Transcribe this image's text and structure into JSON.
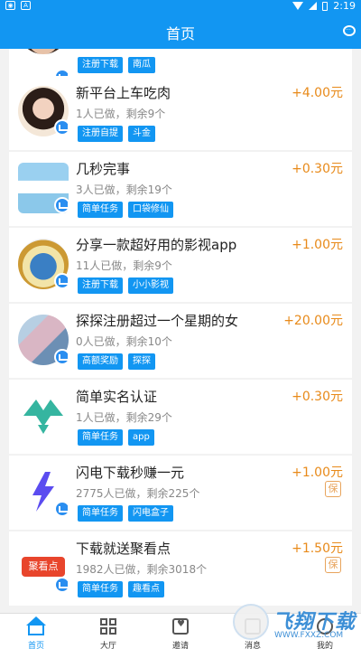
{
  "status_bar": {
    "time": "2:19",
    "left_icons": [
      "game-icon",
      "a-icon"
    ],
    "right_icons": [
      "wifi-icon",
      "signal-icon",
      "battery-icon"
    ]
  },
  "header": {
    "title": "首页",
    "right_icon": "chat-icon"
  },
  "tasks": [
    {
      "title": "",
      "meta": "",
      "reward": "",
      "tags": [
        "注册下载",
        "南瓜"
      ],
      "guarantee": ""
    },
    {
      "title": "新平台上车吃肉",
      "meta": "1人已做，剩余9个",
      "reward": "+4.00元",
      "tags": [
        "注册自提",
        "斗金"
      ],
      "guarantee": ""
    },
    {
      "title": "几秒完事",
      "meta": "3人已做，剩余19个",
      "reward": "+0.30元",
      "tags": [
        "简单任务",
        "口袋修仙"
      ],
      "guarantee": ""
    },
    {
      "title": "分享一款超好用的影视app",
      "meta": "11人已做，剩余9个",
      "reward": "+1.00元",
      "tags": [
        "注册下载",
        "小小影视"
      ],
      "guarantee": ""
    },
    {
      "title": "探探注册超过一个星期的女",
      "meta": "0人已做，剩余10个",
      "reward": "+20.00元",
      "tags": [
        "高额奖励",
        "探探"
      ],
      "guarantee": ""
    },
    {
      "title": "简单实名认证",
      "meta": "1人已做，剩余29个",
      "reward": "+0.30元",
      "tags": [
        "简单任务",
        "app"
      ],
      "guarantee": ""
    },
    {
      "title": "闪电下载秒赚一元",
      "meta": "2775人已做，剩余225个",
      "reward": "+1.00元",
      "tags": [
        "简单任务",
        "闪电盒子"
      ],
      "guarantee": "保"
    },
    {
      "title": "下载就送聚看点",
      "meta": "1982人已做，剩余3018个",
      "reward": "+1.50元",
      "tags": [
        "简单任务",
        "趣看点"
      ],
      "guarantee": "保",
      "logo_text": "聚看点"
    }
  ],
  "tabbar": {
    "items": [
      {
        "label": "首页",
        "icon": "home-icon",
        "active": true
      },
      {
        "label": "大厅",
        "icon": "grid-icon",
        "active": false
      },
      {
        "label": "邀请",
        "icon": "invite-icon",
        "active": false
      },
      {
        "label": "消息",
        "icon": "message-icon",
        "active": false
      },
      {
        "label": "我的",
        "icon": "user-icon",
        "active": false
      }
    ]
  },
  "watermark": {
    "text": "飞翔下载",
    "sub": "WWW.FXXZ.COM"
  },
  "colors": {
    "primary": "#1296f2",
    "reward": "#e88a1a",
    "card_bg": "#ffffff"
  }
}
